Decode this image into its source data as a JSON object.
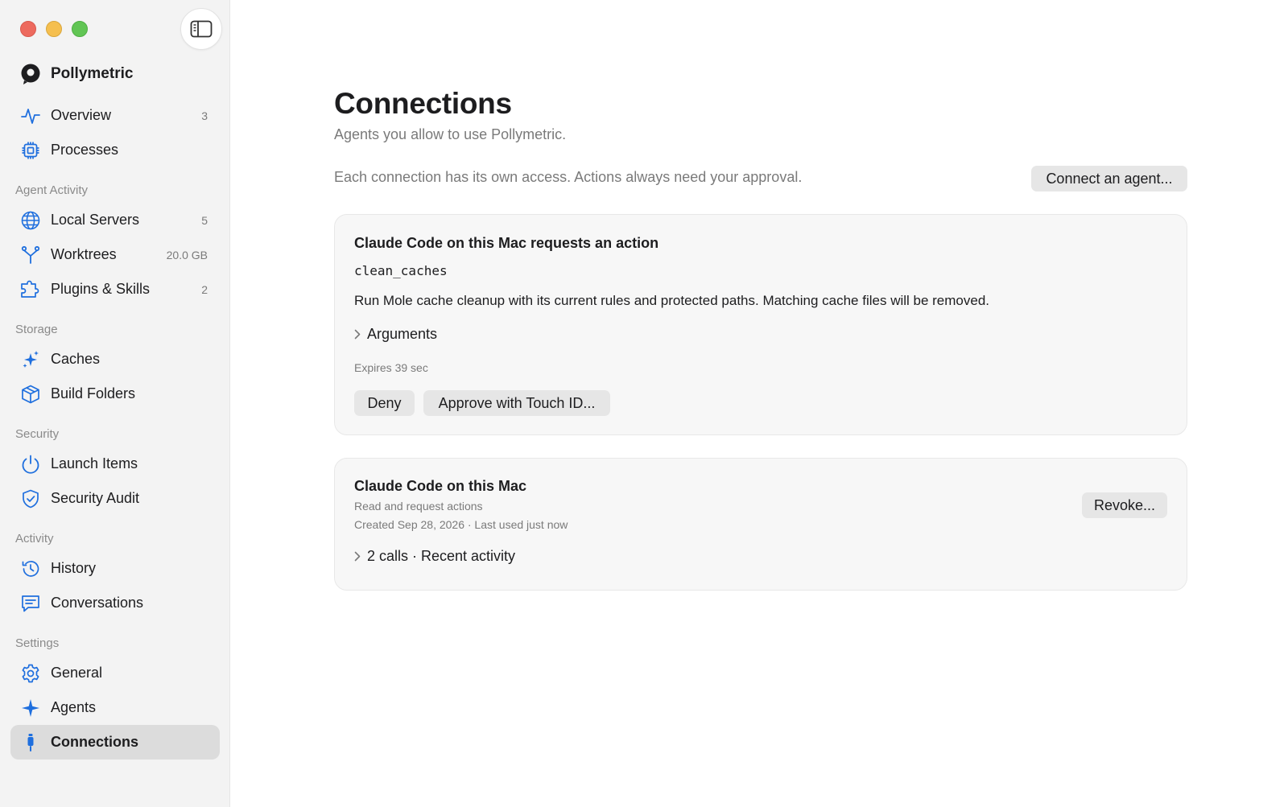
{
  "app": {
    "name": "Pollymetric",
    "accent": "#1f6fde"
  },
  "sidebar": {
    "items": [
      {
        "label": "Overview",
        "count": "3",
        "icon": "activity-icon"
      },
      {
        "label": "Processes",
        "count": "",
        "icon": "cpu-icon"
      },
      {
        "label": "Local Servers",
        "count": "5",
        "icon": "globe-icon"
      },
      {
        "label": "Worktrees",
        "count": "20.0 GB",
        "icon": "branch-icon"
      },
      {
        "label": "Plugins & Skills",
        "count": "2",
        "icon": "plugin-icon"
      },
      {
        "label": "Caches",
        "count": "",
        "icon": "sparkles-icon"
      },
      {
        "label": "Build Folders",
        "count": "",
        "icon": "box-icon"
      },
      {
        "label": "Launch Items",
        "count": "",
        "icon": "power-icon"
      },
      {
        "label": "Security Audit",
        "count": "",
        "icon": "shield-check-icon"
      },
      {
        "label": "History",
        "count": "",
        "icon": "history-icon"
      },
      {
        "label": "Conversations",
        "count": "",
        "icon": "chat-icon"
      },
      {
        "label": "General",
        "count": "",
        "icon": "gear-icon"
      },
      {
        "label": "Agents",
        "count": "",
        "icon": "sparkle-icon"
      },
      {
        "label": "Connections",
        "count": "",
        "icon": "plug-icon"
      }
    ],
    "sections": [
      "Agent Activity",
      "Storage",
      "Security",
      "Activity",
      "Settings"
    ],
    "active": "Connections"
  },
  "main": {
    "title": "Connections",
    "subtitle": "Agents you allow to use Pollymetric.",
    "info": "Each connection has its own access. Actions always need your approval.",
    "connect_button": "Connect an agent...",
    "request": {
      "title": "Claude Code on this Mac requests an action",
      "tool": "clean_caches",
      "description": "Run Mole cache cleanup with its current rules and protected paths. Matching cache files will be removed.",
      "arguments_label": "Arguments",
      "expires": "Expires 39 sec",
      "deny": "Deny",
      "approve": "Approve with Touch ID..."
    },
    "connection": {
      "title": "Claude Code on this Mac",
      "access": "Read and request actions",
      "meta": "Created Sep 28, 2026 · Last used just now",
      "activity": "2 calls · Recent activity",
      "revoke": "Revoke..."
    }
  }
}
